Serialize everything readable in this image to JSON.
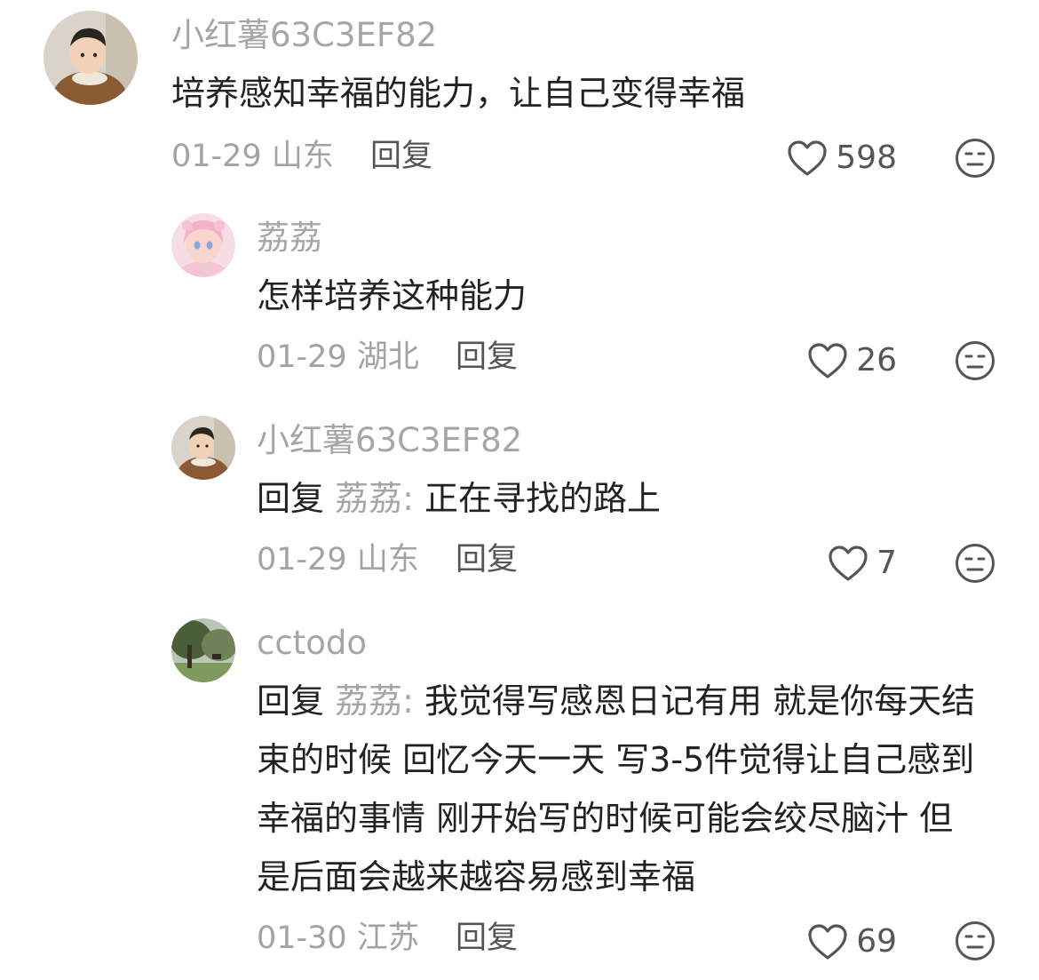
{
  "comments": [
    {
      "avatar": "boy-in-brown-jacket-avatar",
      "username": "小红薯63C3EF82",
      "text": "培养感知幸福的能力，让自己变得幸福",
      "date": "01-29",
      "location": "山东",
      "reply_label": "回复",
      "likes": "598",
      "like_icon": "heart-outline-icon",
      "dislike_icon": "neutral-face-icon"
    },
    {
      "avatar": "pink-anime-girl-avatar",
      "username": "荔荔",
      "text": "怎样培养这种能力",
      "date": "01-29",
      "location": "湖北",
      "reply_label": "回复",
      "likes": "26",
      "like_icon": "heart-outline-icon",
      "dislike_icon": "neutral-face-icon"
    },
    {
      "avatar": "boy-in-brown-jacket-avatar",
      "username": "小红薯63C3EF82",
      "reply_prefix": "回复",
      "reply_target": "荔荔:",
      "text": "正在寻找的路上",
      "date": "01-29",
      "location": "山东",
      "reply_label": "回复",
      "likes": "7",
      "like_icon": "heart-outline-icon",
      "dislike_icon": "neutral-face-icon"
    },
    {
      "avatar": "tree-landscape-avatar",
      "username": "cctodo",
      "reply_prefix": "回复",
      "reply_target": "荔荔:",
      "text": "我觉得写感恩日记有用 就是你每天结束的时候 回忆今天一天 写3-5件觉得让自己感到幸福的事情 刚开始写的时候可能会绞尽脑汁 但是后面会越来越容易感到幸福",
      "date": "01-30",
      "location": "江苏",
      "reply_label": "回复",
      "likes": "69",
      "like_icon": "heart-outline-icon",
      "dislike_icon": "neutral-face-icon"
    }
  ]
}
